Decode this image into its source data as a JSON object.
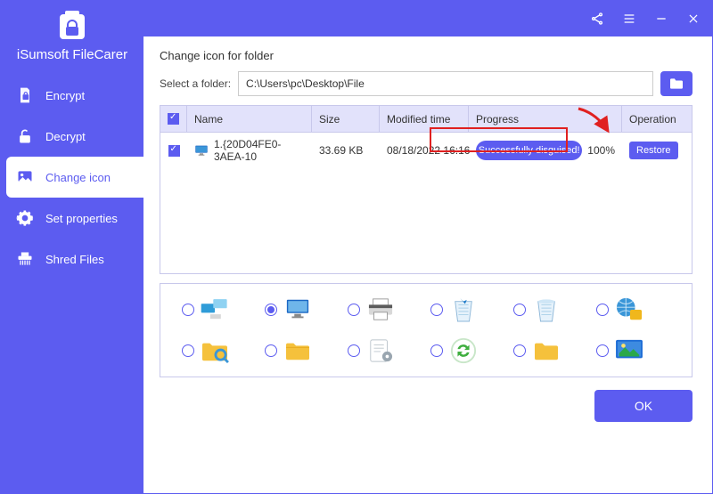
{
  "brand": {
    "name": "iSumsoft FileCarer"
  },
  "sidebar": {
    "items": [
      {
        "label": "Encrypt"
      },
      {
        "label": "Decrypt"
      },
      {
        "label": "Change icon"
      },
      {
        "label": "Set properties"
      },
      {
        "label": "Shred Files"
      }
    ],
    "activeIndex": 2
  },
  "header": {
    "title": "Change icon for folder"
  },
  "folderPicker": {
    "label": "Select a folder:",
    "path": "C:\\Users\\pc\\Desktop\\File"
  },
  "table": {
    "columns": {
      "name": "Name",
      "size": "Size",
      "modified": "Modified time",
      "progress": "Progress",
      "operation": "Operation"
    },
    "rows": [
      {
        "checked": true,
        "name": "1.{20D04FE0-3AEA-10",
        "size": "33.69 KB",
        "modified": "08/18/2022 16:16",
        "progressText": "Successfully disguised!",
        "progressPercent": "100%",
        "operationLabel": "Restore"
      }
    ]
  },
  "iconGrid": {
    "selectedIndex": 1,
    "options": [
      {
        "name": "network-computers-icon",
        "colors": [
          "#2f9cd8",
          "#8fd2f2"
        ]
      },
      {
        "name": "this-pc-icon",
        "colors": [
          "#1c68c4",
          "#e6e6e6"
        ]
      },
      {
        "name": "printer-icon",
        "colors": [
          "#5b5b5b",
          "#d8d8d8"
        ]
      },
      {
        "name": "recycle-bin-full-icon",
        "colors": [
          "#e6f2fb",
          "#1d7bc9"
        ]
      },
      {
        "name": "recycle-bin-empty-icon",
        "colors": [
          "#e6f2fb",
          "#1d7bc9"
        ]
      },
      {
        "name": "globe-network-icon",
        "colors": [
          "#3a96d8",
          "#f0b71c"
        ]
      },
      {
        "name": "folder-search-icon",
        "colors": [
          "#f5c13c",
          "#3a96d8"
        ]
      },
      {
        "name": "folder-yellow-icon",
        "colors": [
          "#f5c13c",
          "#e6a81a"
        ]
      },
      {
        "name": "document-gear-icon",
        "colors": [
          "#ffffff",
          "#9aa6b0"
        ]
      },
      {
        "name": "sync-circle-icon",
        "colors": [
          "#3fae3f",
          "#ffffff"
        ]
      },
      {
        "name": "folder-plain-icon",
        "colors": [
          "#f5c13c",
          "#e6a81a"
        ]
      },
      {
        "name": "desktop-picture-icon",
        "colors": [
          "#1d6cd6",
          "#2aa84a"
        ]
      }
    ]
  },
  "buttons": {
    "ok": "OK"
  }
}
